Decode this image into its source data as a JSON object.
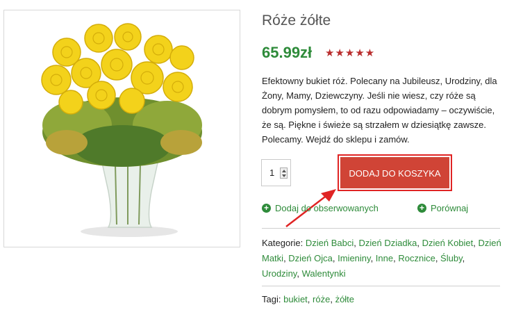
{
  "product": {
    "title": "Róże żółte",
    "price": "65.99zł",
    "rating_stars": "★★★★★",
    "description": "Efektowny bukiet róż. Polecany na Jubileusz, Urodziny, dla Żony, Mamy, Dziewczyny. Jeśli nie wiesz, czy róże są dobrym pomysłem, to od razu odpowiadamy – oczywiście, że są. Piękne i świeże są strzałem w dziesiątkę zawsze. Polecamy. Wejdź do sklepu i zamów."
  },
  "cart": {
    "quantity": "1",
    "button_label": "DODAJ DO KOSZYKA"
  },
  "actions": {
    "wishlist_label": "Dodaj do obserwowanych",
    "compare_label": "Porównaj"
  },
  "meta": {
    "categories_label": "Kategorie:",
    "categories": [
      "Dzień Babci",
      "Dzień Dziadka",
      "Dzień Kobiet",
      "Dzień Matki",
      "Dzień Ojca",
      "Imieniny",
      "Inne",
      "Rocznice",
      "Śluby",
      "Urodziny",
      "Walentynki"
    ],
    "tags_label": "Tagi:",
    "tags": [
      "bukiet",
      "róże",
      "żółte"
    ]
  },
  "colors": {
    "accent_green": "#2e8b3a",
    "cart_red": "#d04436",
    "highlight_red": "#e02424",
    "star_red": "#b92e2e"
  }
}
